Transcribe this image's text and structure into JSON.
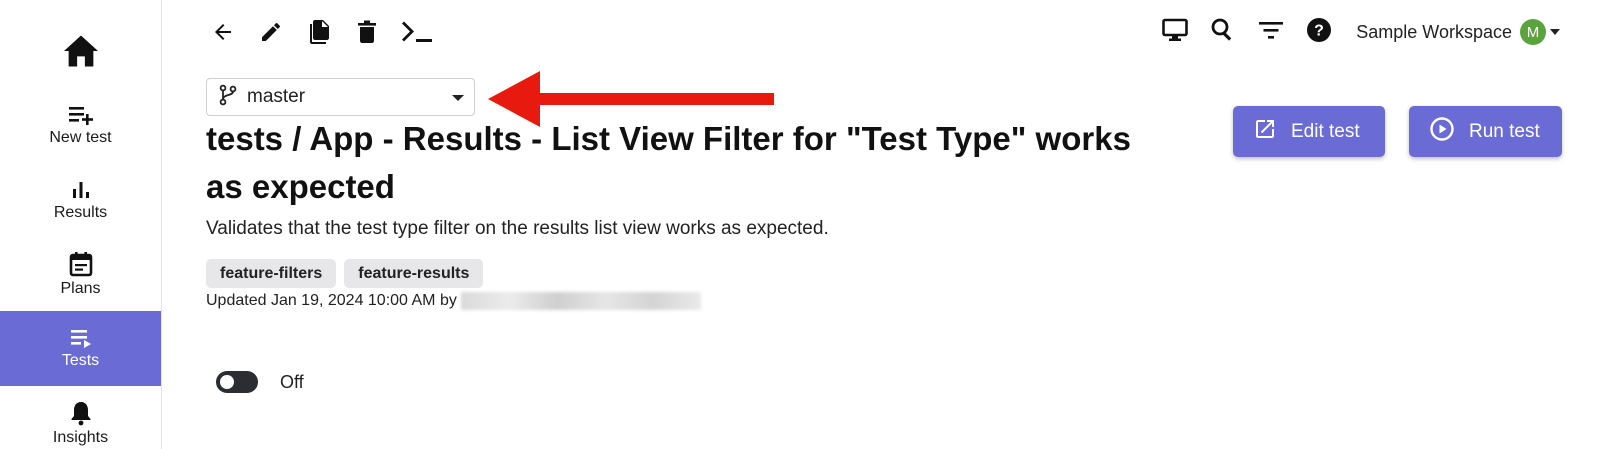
{
  "sidebar": {
    "home_icon": "home-icon",
    "items": [
      {
        "label": "New test",
        "icon": "playlist-add-icon"
      },
      {
        "label": "Results",
        "icon": "bar-chart-icon"
      },
      {
        "label": "Plans",
        "icon": "calendar-icon"
      },
      {
        "label": "Tests",
        "icon": "playlist-play-icon"
      },
      {
        "label": "Insights",
        "icon": "bell-icon"
      }
    ]
  },
  "toolbar": {
    "icons": [
      "back-arrow-icon",
      "pencil-icon",
      "copy-icon",
      "trash-icon",
      "terminal-icon"
    ]
  },
  "top_right": {
    "icons": [
      "monitor-icon",
      "search-icon",
      "filter-icon",
      "help-icon"
    ],
    "workspace_name": "Sample Workspace",
    "avatar_initial": "M"
  },
  "branch": {
    "selected": "master",
    "icon": "git-branch-icon"
  },
  "test": {
    "title": "tests / App - Results - List View Filter for \"Test Type\" works as expected",
    "description": "Validates that the test type filter on the results list view works as expected.",
    "tags": [
      "feature-filters",
      "feature-results"
    ],
    "updated": "Updated Jan 19, 2024 10:00 AM by"
  },
  "actions": {
    "edit_label": "Edit test",
    "run_label": "Run test"
  },
  "toggle": {
    "state_label": "Off",
    "on": false
  },
  "colors": {
    "accent": "#6b6bd6",
    "annotation_arrow": "#e8190e",
    "avatar": "#5aa33d"
  }
}
